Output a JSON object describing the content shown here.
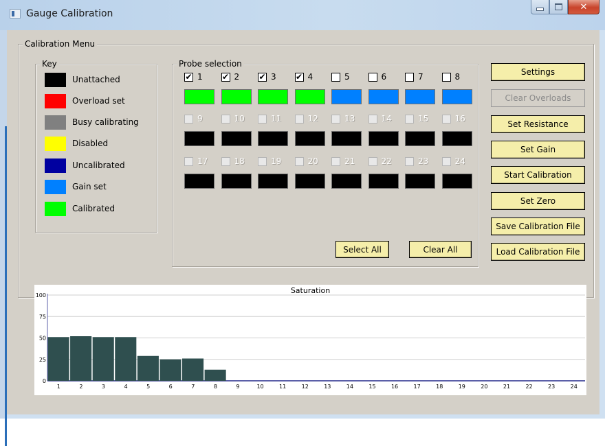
{
  "window": {
    "title": "Gauge Calibration",
    "icon": "app-icon"
  },
  "menu_group": {
    "label": "Calibration Menu"
  },
  "key": {
    "label": "Key",
    "items": [
      {
        "label": "Unattached",
        "color": "#000000"
      },
      {
        "label": "Overload set",
        "color": "#ff0000"
      },
      {
        "label": "Busy calibrating",
        "color": "#808080"
      },
      {
        "label": "Disabled",
        "color": "#ffff00"
      },
      {
        "label": "Uncalibrated",
        "color": "#0000a0"
      },
      {
        "label": "Gain set",
        "color": "#0080ff"
      },
      {
        "label": "Calibrated",
        "color": "#00ff00"
      }
    ]
  },
  "probes": {
    "label": "Probe selection",
    "items": [
      {
        "label": "1",
        "checked": true,
        "enabled": true,
        "color": "#00ff00"
      },
      {
        "label": "2",
        "checked": true,
        "enabled": true,
        "color": "#00ff00"
      },
      {
        "label": "3",
        "checked": true,
        "enabled": true,
        "color": "#00ff00"
      },
      {
        "label": "4",
        "checked": true,
        "enabled": true,
        "color": "#00ff00"
      },
      {
        "label": "5",
        "checked": false,
        "enabled": true,
        "color": "#0080ff"
      },
      {
        "label": "6",
        "checked": false,
        "enabled": true,
        "color": "#0080ff"
      },
      {
        "label": "7",
        "checked": false,
        "enabled": true,
        "color": "#0080ff"
      },
      {
        "label": "8",
        "checked": false,
        "enabled": true,
        "color": "#0080ff"
      },
      {
        "label": "9",
        "checked": false,
        "enabled": false,
        "color": "#000000"
      },
      {
        "label": "10",
        "checked": false,
        "enabled": false,
        "color": "#000000"
      },
      {
        "label": "11",
        "checked": false,
        "enabled": false,
        "color": "#000000"
      },
      {
        "label": "12",
        "checked": false,
        "enabled": false,
        "color": "#000000"
      },
      {
        "label": "13",
        "checked": false,
        "enabled": false,
        "color": "#000000"
      },
      {
        "label": "14",
        "checked": false,
        "enabled": false,
        "color": "#000000"
      },
      {
        "label": "15",
        "checked": false,
        "enabled": false,
        "color": "#000000"
      },
      {
        "label": "16",
        "checked": false,
        "enabled": false,
        "color": "#000000"
      },
      {
        "label": "17",
        "checked": false,
        "enabled": false,
        "color": "#000000"
      },
      {
        "label": "18",
        "checked": false,
        "enabled": false,
        "color": "#000000"
      },
      {
        "label": "19",
        "checked": false,
        "enabled": false,
        "color": "#000000"
      },
      {
        "label": "20",
        "checked": false,
        "enabled": false,
        "color": "#000000"
      },
      {
        "label": "21",
        "checked": false,
        "enabled": false,
        "color": "#000000"
      },
      {
        "label": "22",
        "checked": false,
        "enabled": false,
        "color": "#000000"
      },
      {
        "label": "23",
        "checked": false,
        "enabled": false,
        "color": "#000000"
      },
      {
        "label": "24",
        "checked": false,
        "enabled": false,
        "color": "#000000"
      }
    ],
    "select_all_label": "Select All",
    "clear_all_label": "Clear All"
  },
  "actions": {
    "settings": "Settings",
    "clear_overloads": "Clear Overloads",
    "set_resistance": "Set Resistance",
    "set_gain": "Set Gain",
    "start_calibration": "Start Calibration",
    "set_zero": "Set Zero",
    "save_file": "Save Calibration File",
    "load_file": "Load Calibration File"
  },
  "chart_data": {
    "type": "bar",
    "title": "Saturation",
    "categories": [
      "1",
      "2",
      "3",
      "4",
      "5",
      "6",
      "7",
      "8",
      "9",
      "10",
      "11",
      "12",
      "13",
      "14",
      "15",
      "16",
      "17",
      "18",
      "19",
      "20",
      "21",
      "22",
      "23",
      "24"
    ],
    "values": [
      51,
      52,
      51,
      51,
      29,
      25,
      26,
      13,
      0,
      0,
      0,
      0,
      0,
      0,
      0,
      0,
      0,
      0,
      0,
      0,
      0,
      0,
      0,
      0
    ],
    "yticks": [
      "0",
      "25",
      "50",
      "75",
      "100"
    ],
    "ylim": [
      0,
      100
    ],
    "grid": true,
    "bar_color": "#2f4f4f"
  }
}
